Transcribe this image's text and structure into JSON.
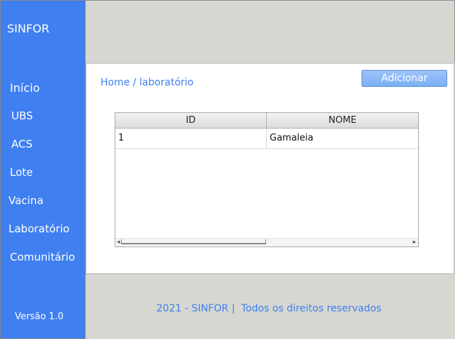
{
  "sidebar": {
    "brand": "SINFOR",
    "items": [
      {
        "label": "Início"
      },
      {
        "label": "UBS"
      },
      {
        "label": "ACS"
      },
      {
        "label": "Lote"
      },
      {
        "label": "Vacina"
      },
      {
        "label": "Laboratório"
      },
      {
        "label": "Comunitário"
      }
    ],
    "version": "Versão 1.0"
  },
  "main": {
    "breadcrumb": {
      "home": "Home",
      "separator": " / ",
      "current": "laboratório"
    },
    "add_button": "Adicionar",
    "table": {
      "columns": [
        "ID",
        "NOME"
      ],
      "rows": [
        {
          "id": "1",
          "nome": "Gamaleia"
        }
      ]
    }
  },
  "footer": {
    "text": "2021 - SINFOR |  Todos os direitos reservados"
  },
  "colors": {
    "accent": "#3f7ff0",
    "background": "#d6d7d0",
    "panel": "#ffffff"
  }
}
